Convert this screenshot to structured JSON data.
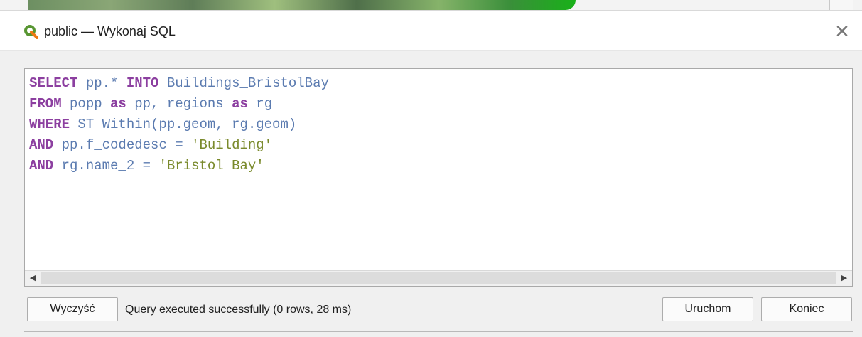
{
  "window": {
    "title": "public — Wykonaj SQL",
    "app_icon": "qgis-icon",
    "close_icon": "close-icon",
    "close_glyph": "✕"
  },
  "editor": {
    "lines": [
      [
        {
          "t": "SELECT",
          "c": "kw"
        },
        {
          "t": " pp.* ",
          "c": ""
        },
        {
          "t": "INTO",
          "c": "kw"
        },
        {
          "t": " Buildings_BristolBay",
          "c": ""
        }
      ],
      [
        {
          "t": "FROM",
          "c": "kw"
        },
        {
          "t": " popp ",
          "c": ""
        },
        {
          "t": "as",
          "c": "kw"
        },
        {
          "t": " pp, regions ",
          "c": ""
        },
        {
          "t": "as",
          "c": "kw"
        },
        {
          "t": " rg",
          "c": ""
        }
      ],
      [
        {
          "t": "WHERE",
          "c": "kw"
        },
        {
          "t": " ST_Within(pp.geom, rg.geom)",
          "c": ""
        }
      ],
      [
        {
          "t": "AND",
          "c": "kw"
        },
        {
          "t": " pp.f_codedesc = ",
          "c": ""
        },
        {
          "t": "'Building'",
          "c": "str"
        }
      ],
      [
        {
          "t": "AND",
          "c": "kw"
        },
        {
          "t": " rg.name_2 = ",
          "c": ""
        },
        {
          "t": "'Bristol Bay'",
          "c": "str"
        }
      ]
    ],
    "colors": {
      "keyword": "#8c3fa0",
      "identifier": "#5b7bb0",
      "string": "#7a8a2c"
    },
    "scroll_left_glyph": "◀",
    "scroll_right_glyph": "▶"
  },
  "footer": {
    "clear_button": "Wyczyść",
    "status": "Query executed successfully (0 rows, 28 ms)",
    "run_button": "Uruchom",
    "close_button": "Koniec"
  }
}
